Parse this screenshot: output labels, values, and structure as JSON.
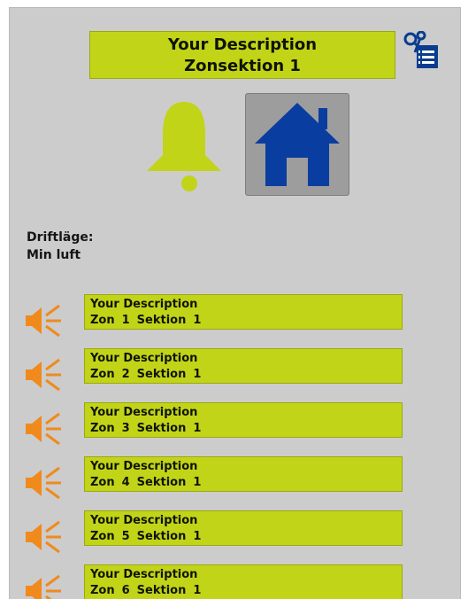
{
  "header": {
    "title_line1": "Your Description",
    "title_line2": "Zonsektion 1"
  },
  "icons": {
    "settings": "settings-edit-icon",
    "bell": "alarm-bell-icon",
    "home": "home-icon",
    "speaker": "speaker-icon"
  },
  "colors": {
    "accent": "#c2d417",
    "speaker": "#f08a1c",
    "home": "#0a3da0",
    "background": "#cccccc"
  },
  "mode": {
    "label": "Driftläge:",
    "value": "Min luft"
  },
  "zones": [
    {
      "description": "Your Description",
      "zon_label": "Zon",
      "zon": "1",
      "sektion_label": "Sektion",
      "sektion": "1"
    },
    {
      "description": "Your Description",
      "zon_label": "Zon",
      "zon": "2",
      "sektion_label": "Sektion",
      "sektion": "1"
    },
    {
      "description": "Your Description",
      "zon_label": "Zon",
      "zon": "3",
      "sektion_label": "Sektion",
      "sektion": "1"
    },
    {
      "description": "Your Description",
      "zon_label": "Zon",
      "zon": "4",
      "sektion_label": "Sektion",
      "sektion": "1"
    },
    {
      "description": "Your Description",
      "zon_label": "Zon",
      "zon": "5",
      "sektion_label": "Sektion",
      "sektion": "1"
    },
    {
      "description": "Your Description",
      "zon_label": "Zon",
      "zon": "6",
      "sektion_label": "Sektion",
      "sektion": "1"
    }
  ]
}
